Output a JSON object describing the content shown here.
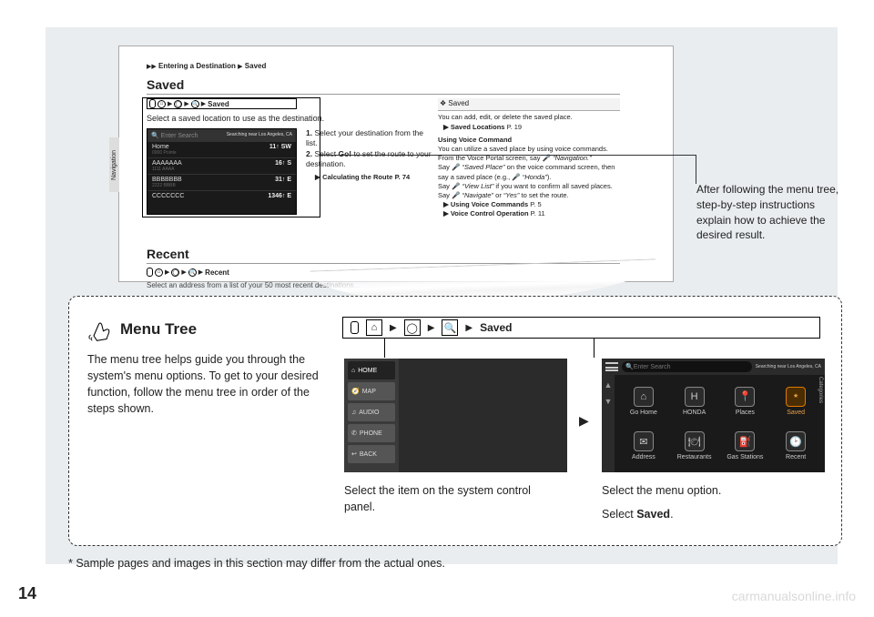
{
  "page_number": "14",
  "watermark": "carmanualsonline.info",
  "breadcrumb_top": {
    "arrow": "▶▶",
    "seg1": "Entering a Destination",
    "arrow2": "▶",
    "seg2": "Saved"
  },
  "sections": {
    "saved_title": "Saved",
    "recent_title": "Recent"
  },
  "crumb_saved_last": "Saved",
  "crumb_recent_last": "Recent",
  "instr_line": "Select a saved location to use as the destination.",
  "recent_desc_partial": "Select an address from a list of your 50 most recent destinations…",
  "nav_shot": {
    "search_placeholder": "Enter Search",
    "search_right": "Searching near\nLos Angeles, CA",
    "rows": [
      {
        "name": "Home",
        "sub": "0000 Pointe",
        "dist": "11↑ SW"
      },
      {
        "name": "AAAAAAA",
        "sub": "1111 AAAA",
        "dist": "16↑ S"
      },
      {
        "name": "BBBBBBB",
        "sub": "2222 BBBB",
        "dist": "31↑ E"
      },
      {
        "name": "CCCCCCC",
        "sub": "",
        "dist": "1346↑ E"
      }
    ]
  },
  "steps": {
    "s1_num": "1.",
    "s1": "Select your destination from the list.",
    "s2_num": "2.",
    "s2a": "Select ",
    "s2_go": "Go!",
    "s2b": " to set the route to your destination.",
    "ref_icon": "▶",
    "ref_label": "Calculating the Route",
    "ref_page": "P. 74"
  },
  "right_col": {
    "hd_icon": "❖",
    "hd": "Saved",
    "l1": "You can add, edit, or delete the saved place.",
    "ref1": "Saved Locations",
    "ref1_p": "P. 19",
    "uvc_head": "Using Voice Command",
    "uvc_1": "You can utilize a saved place by using voice commands.",
    "uvc_2a": "From the Voice Portal screen, say ",
    "uvc_2b": "“Navigation.”",
    "uvc_3a": "Say ",
    "uvc_3b": "“Saved Place”",
    "uvc_3c": " on the voice command screen, then say a saved place (e.g., ",
    "uvc_3d": "“Honda”",
    "uvc_3e": ").",
    "uvc_4a": "Say ",
    "uvc_4b": "“View List”",
    "uvc_4c": " if you want to confirm all saved places.",
    "uvc_5a": "Say ",
    "uvc_5b": "“Navigate”",
    "uvc_5c": " or ",
    "uvc_5d": "“Yes”",
    "uvc_5e": " to set the route.",
    "ref2": "Using Voice Commands",
    "ref2_p": "P. 5",
    "ref3": "Voice Control Operation",
    "ref3_p": "P. 11"
  },
  "side_tab": "Navigation",
  "callout": "After following the menu tree, step-by-step instructions explain how to achieve the desired result.",
  "menu_tree": {
    "title": "Menu Tree",
    "para": "The menu tree helps guide you through the system's menu options. To get to your desired function, follow the menu tree in order of the steps shown."
  },
  "panel_bar": {
    "home": "⌂",
    "nav": "◯",
    "dest": "🔍",
    "last": "Saved",
    "arrow": "▶"
  },
  "sys_panel_items": [
    {
      "icon": "⌂",
      "label": "HOME",
      "on": true
    },
    {
      "icon": "🧭",
      "label": "MAP"
    },
    {
      "icon": "♫",
      "label": "AUDIO"
    },
    {
      "icon": "✆",
      "label": "PHONE"
    },
    {
      "icon": "↩",
      "label": "BACK"
    }
  ],
  "nav_panel": {
    "search_placeholder": "Enter Search",
    "search_right": "Searching near\nLos Angeles, CA",
    "cells": [
      {
        "icon": "⌂",
        "label": "Go Home"
      },
      {
        "icon": "H",
        "label": "HONDA"
      },
      {
        "icon": "📍",
        "label": "Places"
      },
      {
        "icon": "⭑",
        "label": "Saved",
        "saved": true
      },
      {
        "icon": "✉",
        "label": "Address"
      },
      {
        "icon": "🍽",
        "label": "Restaurants"
      },
      {
        "icon": "⛽",
        "label": "Gas Stations"
      },
      {
        "icon": "🕑",
        "label": "Recent"
      }
    ],
    "side_cat": "Categories"
  },
  "captions": {
    "c1": "Select the item on the system control panel.",
    "c2a": "Select the menu option.",
    "c2b_pre": "Select ",
    "c2b_bold": "Saved",
    "c2b_post": "."
  },
  "footnote": "* Sample pages and images in this section may differ from the actual ones."
}
